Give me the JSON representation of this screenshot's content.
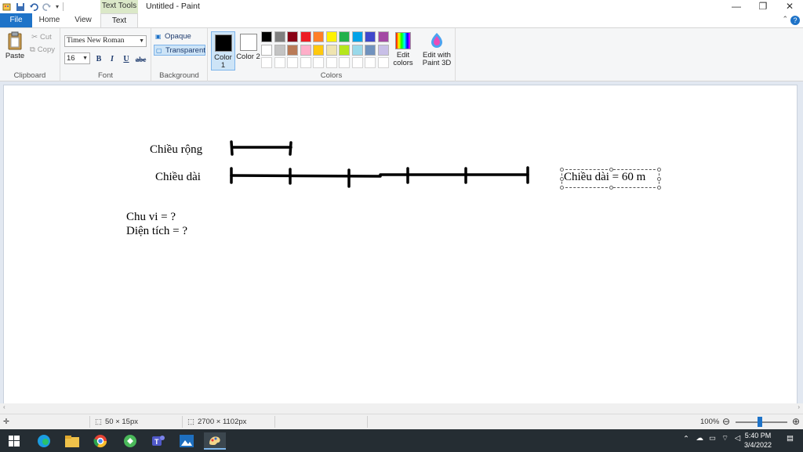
{
  "window": {
    "title": "Untitled - Paint",
    "context_group": "Text Tools",
    "controls": {
      "minimize": "—",
      "restore": "❐",
      "close": "✕"
    }
  },
  "tabs": {
    "file": "File",
    "home": "Home",
    "view": "View",
    "text": "Text"
  },
  "ribbon": {
    "clipboard": {
      "label": "Clipboard",
      "paste": "Paste",
      "cut": "Cut",
      "copy": "Copy"
    },
    "font": {
      "label": "Font",
      "name": "Times New Roman",
      "size": "16",
      "bold": "B",
      "italic": "I",
      "underline": "U",
      "strike": "abc"
    },
    "background": {
      "label": "Background",
      "opaque": "Opaque",
      "transparent": "Transparent"
    },
    "colors": {
      "label": "Colors",
      "color1": "Color 1",
      "color2": "Color 2",
      "color1_value": "#000000",
      "color2_value": "#ffffff",
      "palette_row1": [
        "#000000",
        "#7f7f7f",
        "#880015",
        "#ed1c24",
        "#ff7f27",
        "#fff200",
        "#22b14c",
        "#00a2e8",
        "#3f48cc",
        "#a349a4"
      ],
      "palette_row2": [
        "#ffffff",
        "#c3c3c3",
        "#b97a57",
        "#ffaec9",
        "#ffc90e",
        "#efe4b0",
        "#b5e61d",
        "#99d9ea",
        "#7092be",
        "#c8bfe7"
      ],
      "edit_colors": "Edit colors",
      "paint3d": "Edit with Paint 3D"
    }
  },
  "canvas": {
    "label_width": "Chiều rộng",
    "label_length": "Chiều dài",
    "perimeter": "Chu vi = ?",
    "area": "Diện tích = ?",
    "text_box": "Chiều dài = 60 m"
  },
  "statusbar": {
    "selection_size": "50 × 15px",
    "canvas_size": "2700 × 1102px",
    "zoom": "100%"
  },
  "taskbar": {
    "time": "5:40 PM",
    "date": "3/4/2022"
  }
}
